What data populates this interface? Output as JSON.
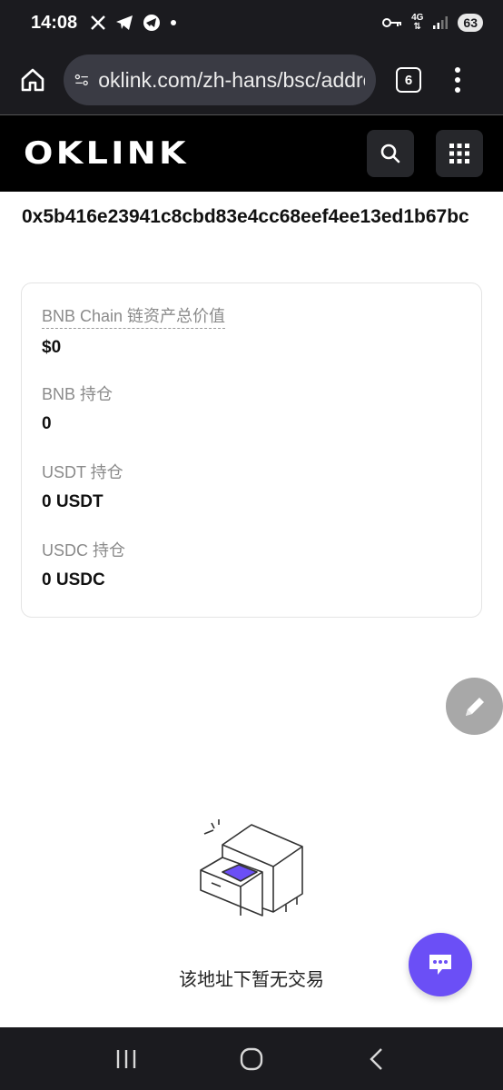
{
  "status_bar": {
    "time": "14:08",
    "left_icons": [
      "x-icon",
      "telegram-icon",
      "telegram-icon",
      "dot-icon"
    ],
    "network": "4G",
    "battery": "63"
  },
  "browser": {
    "url": "oklink.com/zh-hans/bsc/address/0x5b416e",
    "tab_count": "6"
  },
  "header": {
    "logo": "OKLINK"
  },
  "address": "0x5b416e23941c8cbd83e4cc68eef4ee13ed1b67bc",
  "assets": [
    {
      "label": "BNB Chain 链资产总价值",
      "value": "$0"
    },
    {
      "label": "BNB 持仓",
      "value": "0"
    },
    {
      "label": "USDT 持仓",
      "value": "0 USDT"
    },
    {
      "label": "USDC 持仓",
      "value": "0 USDC"
    }
  ],
  "empty_state": {
    "text": "该地址下暂无交易"
  },
  "colors": {
    "accent": "#6b4ff6",
    "dark_bg": "#1b1b1f",
    "header_bg": "#000000"
  }
}
